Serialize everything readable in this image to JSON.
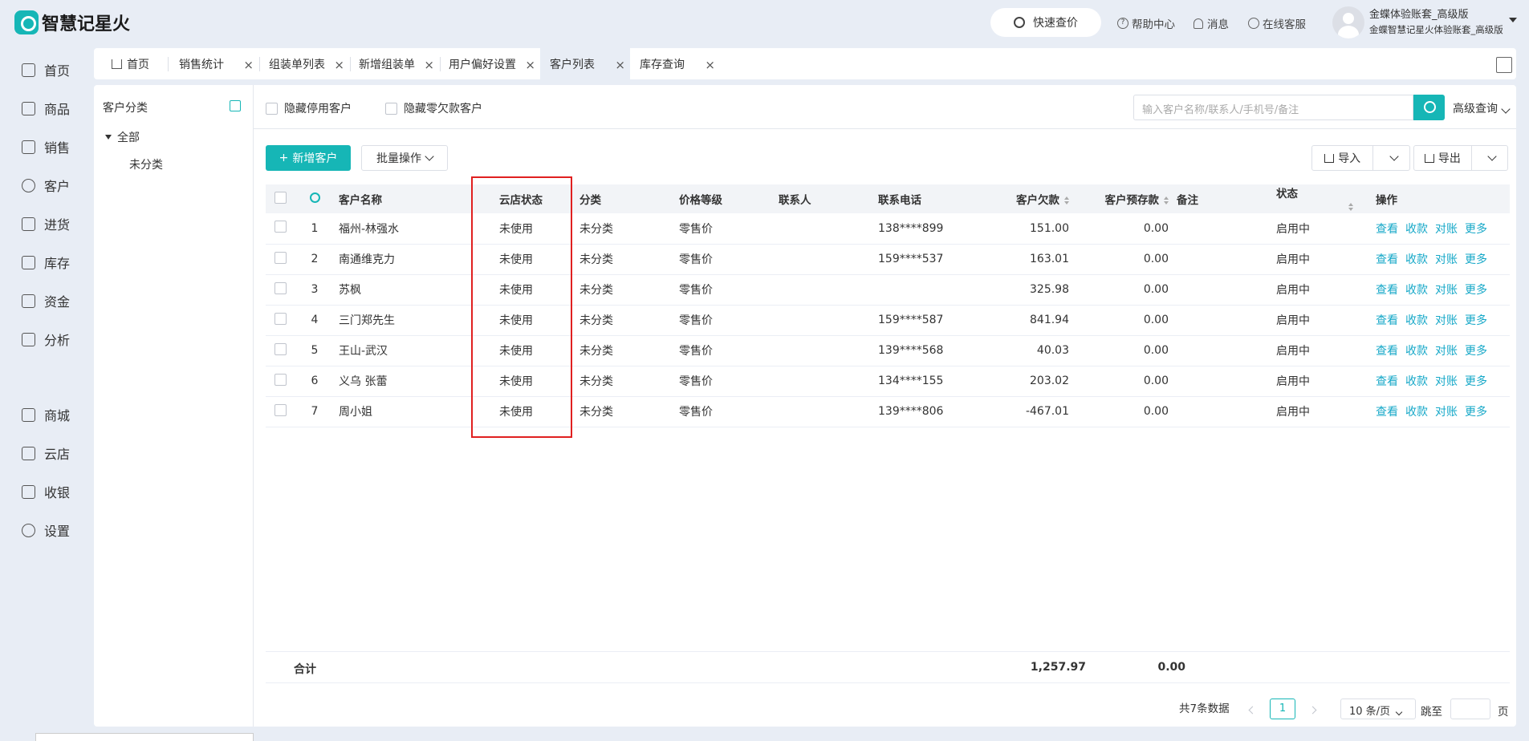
{
  "app": {
    "name": "智慧记星火"
  },
  "header": {
    "quick_price": "快速查价",
    "help": "帮助中心",
    "messages": "消息",
    "service": "在线客服",
    "user_line1": "金蝶体验账套_高级版",
    "user_line2": "金蝶智慧记星火体验账套_高级版"
  },
  "sidebar": {
    "items": [
      {
        "label": "首页",
        "icon": "home-icon"
      },
      {
        "label": "商品",
        "icon": "box-icon"
      },
      {
        "label": "销售",
        "icon": "sales-icon"
      },
      {
        "label": "客户",
        "icon": "user-icon"
      },
      {
        "label": "进货",
        "icon": "purchase-icon"
      },
      {
        "label": "库存",
        "icon": "warehouse-icon"
      },
      {
        "label": "资金",
        "icon": "wallet-icon"
      },
      {
        "label": "分析",
        "icon": "chart-icon"
      },
      {
        "label": "商城",
        "icon": "shop-icon"
      },
      {
        "label": "云店",
        "icon": "cloud-store-icon"
      },
      {
        "label": "收银",
        "icon": "cashier-icon"
      },
      {
        "label": "设置",
        "icon": "gear-icon"
      }
    ]
  },
  "tabs": [
    "首页",
    "销售统计",
    "组装单列表",
    "新增组装单",
    "用户偏好设置",
    "客户列表",
    "库存查询"
  ],
  "category": {
    "title": "客户分类",
    "all": "全部",
    "sub": "未分类"
  },
  "filters": {
    "hide_disabled": "隐藏停用客户",
    "hide_zero_debt": "隐藏零欠款客户",
    "search_placeholder": "输入客户名称/联系人/手机号/备注",
    "advanced": "高级查询"
  },
  "toolbar": {
    "add": "新增客户",
    "batch": "批量操作",
    "import": "导入",
    "export": "导出"
  },
  "table": {
    "columns": [
      "客户名称",
      "云店状态",
      "分类",
      "价格等级",
      "联系人",
      "联系电话",
      "客户欠款",
      "客户预存款",
      "备注",
      "状态",
      "操作"
    ],
    "rows": [
      {
        "no": "1",
        "name": "福州-林强水",
        "cloud": "未使用",
        "cat": "未分类",
        "price": "零售价",
        "contact": "",
        "phone": "138****899",
        "debt": "151.00",
        "deposit": "0.00",
        "remark": "",
        "status": "启用中"
      },
      {
        "no": "2",
        "name": "南通维克力",
        "cloud": "未使用",
        "cat": "未分类",
        "price": "零售价",
        "contact": "",
        "phone": "159****537",
        "debt": "163.01",
        "deposit": "0.00",
        "remark": "",
        "status": "启用中"
      },
      {
        "no": "3",
        "name": "苏枫",
        "cloud": "未使用",
        "cat": "未分类",
        "price": "零售价",
        "contact": "",
        "phone": "",
        "debt": "325.98",
        "deposit": "0.00",
        "remark": "",
        "status": "启用中"
      },
      {
        "no": "4",
        "name": "三门郑先生",
        "cloud": "未使用",
        "cat": "未分类",
        "price": "零售价",
        "contact": "",
        "phone": "159****587",
        "debt": "841.94",
        "deposit": "0.00",
        "remark": "",
        "status": "启用中"
      },
      {
        "no": "5",
        "name": "王山-武汉",
        "cloud": "未使用",
        "cat": "未分类",
        "price": "零售价",
        "contact": "",
        "phone": "139****568",
        "debt": "40.03",
        "deposit": "0.00",
        "remark": "",
        "status": "启用中"
      },
      {
        "no": "6",
        "name": "义乌 张蕾",
        "cloud": "未使用",
        "cat": "未分类",
        "price": "零售价",
        "contact": "",
        "phone": "134****155",
        "debt": "203.02",
        "deposit": "0.00",
        "remark": "",
        "status": "启用中"
      },
      {
        "no": "7",
        "name": "周小姐",
        "cloud": "未使用",
        "cat": "未分类",
        "price": "零售价",
        "contact": "",
        "phone": "139****806",
        "debt": "-467.01",
        "deposit": "0.00",
        "remark": "",
        "status": "启用中"
      }
    ],
    "actions": [
      "查看",
      "收款",
      "对账",
      "更多"
    ]
  },
  "totals": {
    "label": "合计",
    "debt": "1,257.97",
    "deposit": "0.00"
  },
  "pagination": {
    "total": "共7条数据",
    "current": "1",
    "page_size": "10 条/页",
    "jump": "跳至",
    "page_unit": "页"
  },
  "colors": {
    "accent": "#16b6b6",
    "link": "#16a8c8",
    "highlight_box": "#e02020"
  }
}
